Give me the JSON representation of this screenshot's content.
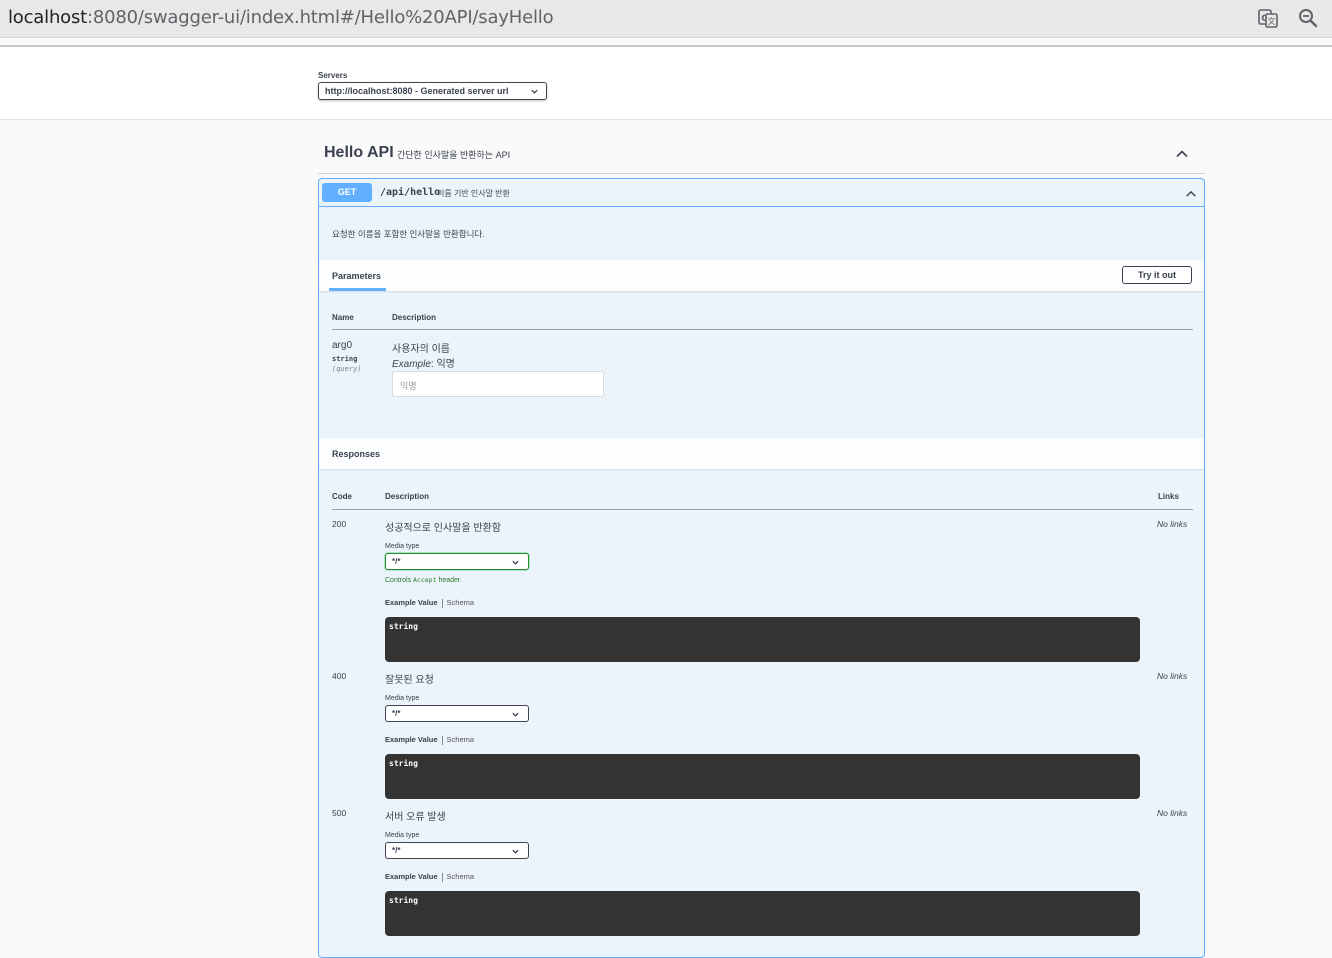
{
  "browser": {
    "url_host": "localhost",
    "url_rest": ":8080/swagger-ui/index.html#/Hello%20API/sayHello",
    "translate_icon": "translate-icon",
    "zoom_icon": "zoom-out-icon"
  },
  "servers": {
    "label": "Servers",
    "selected": "http://localhost:8080 - Generated server url"
  },
  "tag": {
    "name": "Hello API",
    "description": "간단한 인사말을 반환하는 API"
  },
  "operation": {
    "method": "GET",
    "path": "/api/hello",
    "summary": "이름 기반 인사말 반환",
    "description": "요청한 이름을 포함한 인사말을 반환합니다."
  },
  "parameters": {
    "tab_label": "Parameters",
    "try_label": "Try it out",
    "col_name": "Name",
    "col_desc": "Description",
    "items": [
      {
        "name": "arg0",
        "type": "string",
        "in": "(query)",
        "description": "사용자의 이름",
        "example_label": "Example",
        "example_value": ": 익명",
        "placeholder": "익명"
      }
    ]
  },
  "responses": {
    "title": "Responses",
    "col_code": "Code",
    "col_desc": "Description",
    "col_links": "Links",
    "media_label": "Media type",
    "media_value": "*/*",
    "controls_prefix": "Controls ",
    "controls_code": "Accept",
    "controls_suffix": " header.",
    "tab_example": "Example Value",
    "tab_schema": "Schema",
    "no_links": "No links",
    "items": [
      {
        "code": "200",
        "description": "성공적으로 인사말을 반환함",
        "example": "string"
      },
      {
        "code": "400",
        "description": "잘못된 요청",
        "example": "string"
      },
      {
        "code": "500",
        "description": "서버 오류 발생",
        "example": "string"
      }
    ]
  },
  "colors": {
    "get_blue": "#61affe",
    "op_bg": "#ebf3fb",
    "code_bg": "#333333"
  }
}
